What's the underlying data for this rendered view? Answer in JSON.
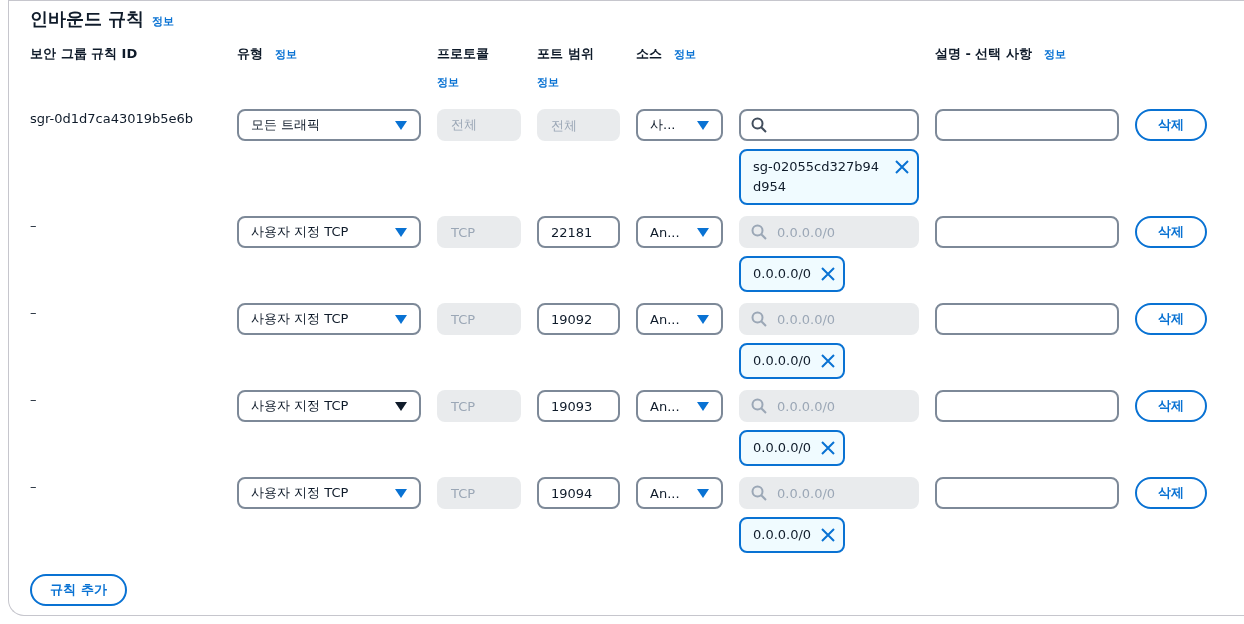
{
  "section": {
    "title": "인바운드 규칙",
    "info": "정보"
  },
  "columns": [
    {
      "label": "보안 그룹 규칙 ID"
    },
    {
      "label": "유형",
      "info": "정보"
    },
    {
      "label": "프로토콜",
      "info": "정보"
    },
    {
      "label": "포트 범위",
      "info": "정보"
    },
    {
      "label": "소스",
      "info": "정보"
    },
    {},
    {
      "label": "설명 - 선택 사항",
      "info": "정보"
    }
  ],
  "rules": [
    {
      "id": "sgr-0d1d7ca43019b5e6b",
      "type": "모든 트래픽",
      "type_focused": false,
      "protocol": "전체",
      "port": {
        "placeholder": "전체",
        "disabled": true
      },
      "source": "사...",
      "search": {
        "disabled": false
      },
      "tag": "sg-02055cd327b94d954",
      "delete": "삭제"
    },
    {
      "id": "–",
      "type": "사용자 지정 TCP",
      "type_focused": false,
      "protocol": "TCP",
      "port": {
        "value": "22181",
        "disabled": false
      },
      "source": "An...",
      "search": {
        "placeholder": "0.0.0.0/0",
        "disabled": true
      },
      "tag": "0.0.0.0/0",
      "delete": "삭제"
    },
    {
      "id": "–",
      "type": "사용자 지정 TCP",
      "type_focused": false,
      "protocol": "TCP",
      "port": {
        "value": "19092",
        "disabled": false
      },
      "source": "An...",
      "search": {
        "placeholder": "0.0.0.0/0",
        "disabled": true
      },
      "tag": "0.0.0.0/0",
      "delete": "삭제"
    },
    {
      "id": "–",
      "type": "사용자 지정 TCP",
      "type_focused": true,
      "protocol": "TCP",
      "port": {
        "value": "19093",
        "disabled": false
      },
      "source": "An...",
      "search": {
        "placeholder": "0.0.0.0/0",
        "disabled": true
      },
      "tag": "0.0.0.0/0",
      "delete": "삭제"
    },
    {
      "id": "–",
      "type": "사용자 지정 TCP",
      "type_focused": false,
      "protocol": "TCP",
      "port": {
        "value": "19094",
        "disabled": false
      },
      "source": "An...",
      "search": {
        "placeholder": "0.0.0.0/0",
        "disabled": true
      },
      "tag": "0.0.0.0/0",
      "delete": "삭제"
    }
  ],
  "add_button": "규칙 추가"
}
